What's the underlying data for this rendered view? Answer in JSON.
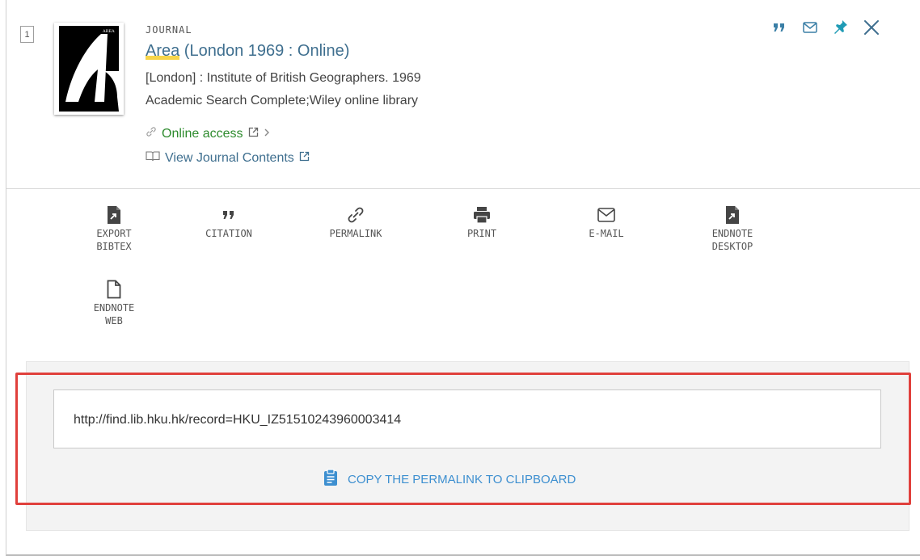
{
  "record": {
    "number": "1",
    "type": "JOURNAL",
    "title_highlight": "Area",
    "title_rest": " (London 1969 : Online)",
    "publisher": "[London] : Institute of British Geographers. 1969",
    "sources": "Academic Search Complete;Wiley online library",
    "online_access": "Online access",
    "view_contents": "View Journal Contents",
    "thumbnail_label": "AREA"
  },
  "top_actions": [
    "citation-icon",
    "email-icon",
    "pin-icon",
    "close-icon"
  ],
  "actions": [
    {
      "line1": "EXPORT",
      "line2": "BIBTEX",
      "icon": "export-file-icon"
    },
    {
      "line1": "CITATION",
      "line2": "",
      "icon": "quote-icon"
    },
    {
      "line1": "PERMALINK",
      "line2": "",
      "icon": "link-icon"
    },
    {
      "line1": "PRINT",
      "line2": "",
      "icon": "printer-icon"
    },
    {
      "line1": "E-MAIL",
      "line2": "",
      "icon": "envelope-icon"
    },
    {
      "line1": "ENDNOTE",
      "line2": "DESKTOP",
      "icon": "export-file-icon"
    },
    {
      "line1": "ENDNOTE",
      "line2": "WEB",
      "icon": "document-icon"
    }
  ],
  "permalink": {
    "url": "http://find.lib.hku.hk/record=HKU_IZ51510243960003414",
    "copy_label": "COPY THE PERMALINK TO CLIPBOARD"
  },
  "colors": {
    "link": "#3f6f8f",
    "online": "#2e8b2e",
    "accent": "#3d8fd0",
    "pin": "#1f9bb5",
    "highlight_border": "#e0403c"
  }
}
